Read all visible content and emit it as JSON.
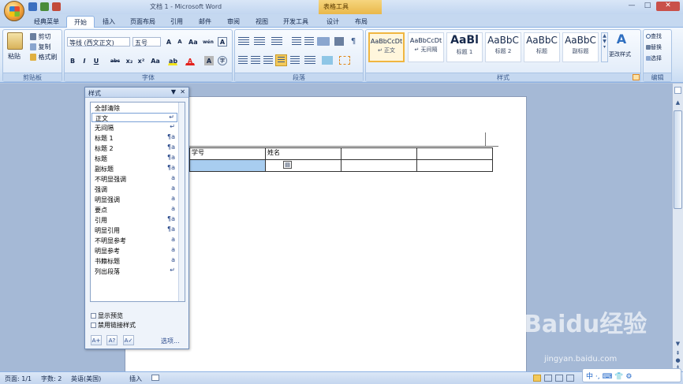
{
  "window": {
    "title": "文档 1 - Microsoft Word",
    "contextual_tab_group": "表格工具",
    "controls": [
      "—",
      "□",
      "✕"
    ]
  },
  "tabs": [
    "经典菜单",
    "开始",
    "插入",
    "页面布局",
    "引用",
    "邮件",
    "审阅",
    "视图",
    "开发工具",
    "设计",
    "布局"
  ],
  "ribbon": {
    "clipboard": {
      "paste": "粘贴",
      "cut": "剪切",
      "copy": "复制",
      "format_painter": "格式刷",
      "label": "剪贴板"
    },
    "font": {
      "font_name": "等线 (西文正文)",
      "font_size": "五号",
      "grow": "A",
      "shrink": "A",
      "clear": "Aa",
      "wen": "wén",
      "char_border": "A",
      "bold": "B",
      "italic": "I",
      "underline": "U",
      "strike": "abc",
      "sub": "x₂",
      "sup": "x²",
      "case": "Aa",
      "highlight": "ab",
      "color": "A",
      "shading": "A",
      "enclose": "字",
      "label": "字体"
    },
    "paragraph": {
      "label": "段落"
    },
    "styles": {
      "gallery": [
        {
          "preview": "AaBbCcDt",
          "name": "↵ 正文"
        },
        {
          "preview": "AaBbCcDt",
          "name": "↵ 无间隔"
        },
        {
          "preview": "AaBl",
          "name": "标题 1"
        },
        {
          "preview": "AaBbC",
          "name": "标题 2"
        },
        {
          "preview": "AaBbC",
          "name": "标题"
        },
        {
          "preview": "AaBbC",
          "name": "副标题"
        }
      ],
      "change_styles": "更改样式",
      "label": "样式"
    },
    "editing": {
      "find": "查找",
      "replace": "替换",
      "select": "选择",
      "label": "编辑"
    }
  },
  "table": {
    "rows": [
      [
        "学号",
        "姓名",
        "",
        ""
      ],
      [
        "",
        "",
        "",
        ""
      ]
    ]
  },
  "styles_pane": {
    "title": "样式",
    "items": [
      {
        "name": "全部清除",
        "mark": ""
      },
      {
        "name": "正文",
        "mark": "↵"
      },
      {
        "name": "无间隔",
        "mark": "↵"
      },
      {
        "name": "标题 1",
        "mark": "¶a"
      },
      {
        "name": "标题 2",
        "mark": "¶a"
      },
      {
        "name": "标题",
        "mark": "¶a"
      },
      {
        "name": "副标题",
        "mark": "¶a"
      },
      {
        "name": "不明显强调",
        "mark": "a"
      },
      {
        "name": "强调",
        "mark": "a"
      },
      {
        "name": "明显强调",
        "mark": "a"
      },
      {
        "name": "要点",
        "mark": "a"
      },
      {
        "name": "引用",
        "mark": "¶a"
      },
      {
        "name": "明显引用",
        "mark": "¶a"
      },
      {
        "name": "不明显参考",
        "mark": "a"
      },
      {
        "name": "明显参考",
        "mark": "a"
      },
      {
        "name": "书籍标题",
        "mark": "a"
      },
      {
        "name": "列出段落",
        "mark": "↵"
      }
    ],
    "show_preview": "显示预览",
    "disable_linked": "禁用链接样式",
    "options": "选项..."
  },
  "status": {
    "page": "页面: 1/1",
    "words": "字数: 2",
    "language": "英语(美国)",
    "insert": "插入"
  },
  "watermark": {
    "brand": "Baidu经验",
    "url": "jingyan.baidu.com"
  },
  "ime": {
    "text": "中 ·, ⌨ 👕 ⚙"
  }
}
